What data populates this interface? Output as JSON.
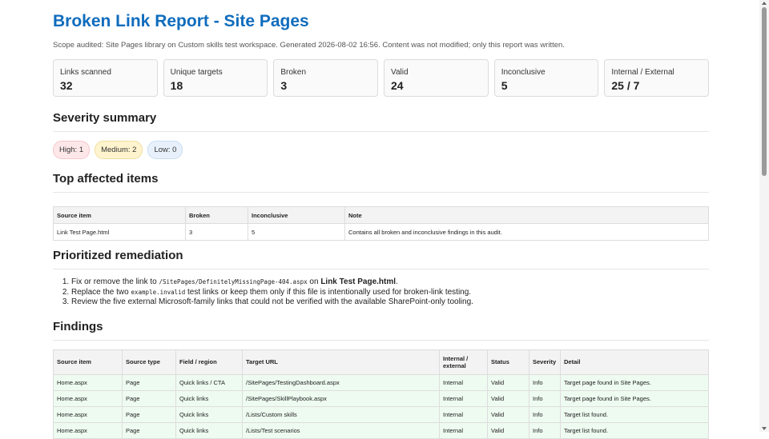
{
  "title": "Broken Link Report - Site Pages",
  "scope": "Scope audited: Site Pages library on Custom skills test workspace. Generated 2026-08-02 16:56. Content was not modified; only this report was written.",
  "stats": [
    {
      "label": "Links scanned",
      "value": "32"
    },
    {
      "label": "Unique targets",
      "value": "18"
    },
    {
      "label": "Broken",
      "value": "3"
    },
    {
      "label": "Valid",
      "value": "24"
    },
    {
      "label": "Inconclusive",
      "value": "5"
    },
    {
      "label": "Internal / External",
      "value": "25 / 7"
    }
  ],
  "severity": {
    "heading": "Severity summary",
    "high": "High: 1",
    "medium": "Medium: 2",
    "low": "Low: 0"
  },
  "top": {
    "heading": "Top affected items",
    "columns": [
      "Source item",
      "Broken",
      "Inconclusive",
      "Note"
    ],
    "row": {
      "source": "Link Test Page.html",
      "broken": "3",
      "inconclusive": "5",
      "note": "Contains all broken and inconclusive findings in this audit."
    }
  },
  "remediation": {
    "heading": "Prioritized remediation",
    "item1_a": "Fix or remove the link to ",
    "item1_code": "/SitePages/DefinitelyMissingPage-404.aspx",
    "item1_b": " on ",
    "item1_bold": "Link Test Page.html",
    "item1_c": ".",
    "item2_a": "Replace the two ",
    "item2_code": "example.invalid",
    "item2_b": " test links or keep them only if this file is intentionally used for broken-link testing.",
    "item3": "Review the five external Microsoft-family links that could not be verified with the available SharePoint-only tooling."
  },
  "findings": {
    "heading": "Findings",
    "columns": [
      "Source item",
      "Source type",
      "Field / region",
      "Target URL",
      "Internal / external",
      "Status",
      "Severity",
      "Detail"
    ],
    "rows": [
      {
        "source": "Home.aspx",
        "type": "Page",
        "field": "Quick links / CTA",
        "url": "/SitePages/TestingDashboard.aspx",
        "scope": "Internal",
        "status": "Valid",
        "severity": "Info",
        "detail": "Target page found in Site Pages."
      },
      {
        "source": "Home.aspx",
        "type": "Page",
        "field": "Quick links",
        "url": "/SitePages/SkillPlaybook.aspx",
        "scope": "Internal",
        "status": "Valid",
        "severity": "Info",
        "detail": "Target page found in Site Pages."
      },
      {
        "source": "Home.aspx",
        "type": "Page",
        "field": "Quick links",
        "url": "/Lists/Custom skills",
        "scope": "Internal",
        "status": "Valid",
        "severity": "Info",
        "detail": "Target list found."
      },
      {
        "source": "Home.aspx",
        "type": "Page",
        "field": "Quick links",
        "url": "/Lists/Test scenarios",
        "scope": "Internal",
        "status": "Valid",
        "severity": "Info",
        "detail": "Target list found."
      }
    ]
  }
}
